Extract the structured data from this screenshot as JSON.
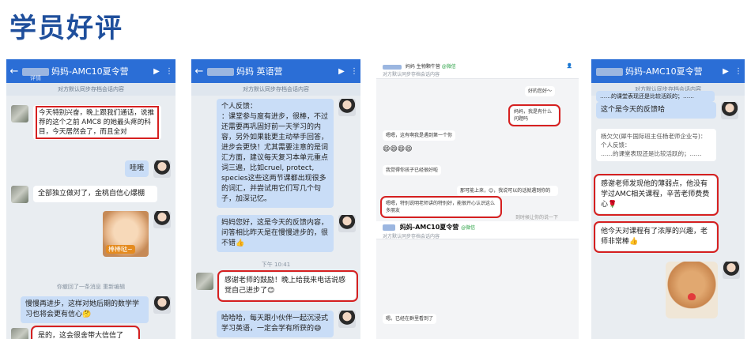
{
  "page_title": "学员好评",
  "panel1": {
    "header_title": "妈妈-AMC10夏令营",
    "header_sub": "详情",
    "notice": "对方默认同步存档会话内容",
    "msg1": "今天特别兴奋，晚上跟我们通话，说推荐的这个之前 AMC8 的她最头疼的科目，今天居然会了，而且全对",
    "msg2": "哇哦",
    "msg3": "全部独立做对了，金桃自信心爆棚",
    "sticker_text": "棒棒哒~",
    "recall": "你撤回了一条消息 重新编辑",
    "msg4": "慢慢再进步，这样对她后期的数学学习也将会更有信心🤔",
    "msg5": "是的，这会很舍带大信信了"
  },
  "panel2": {
    "header_title": "妈妈 英语营",
    "notice": "对方默认同步存档会话内容",
    "msg1": "个人反馈：\n：课堂参与度有进步，很棒，不过还需要再巩固好前一天学习的内容，另外如果能更主动举手回答，进步会更快！尤其需要注意的是词汇方面，建议每天复习本单元重点词三遍，比如cruel, protect, species这些这两节课都出现很多的词汇，并尝试用它们写几个句子，加深记忆。",
    "msg2": "妈妈您好，这是今天的反馈内容，问答相比昨天是在慢慢进步的，很不错👍",
    "time": "下午 10:41",
    "msg3": "感谢老师的鼓励！晚上给我来电话说感觉自己进步了😊",
    "msg4": "哈哈哈，每天跟小伙伴一起沉浸式学习英语，一定会学有所获的😅"
  },
  "panel3": {
    "header_title": "妈妈 生物颗牛营",
    "header_badge": "@微信",
    "header_sub": "对方默认同步存档会话内容",
    "m1": "好的您好～",
    "m2": "妈妈，我是有什么问题吗",
    "m3": "嗯嗯，这有啊我是遇到第一个你",
    "m4": "😄😄😄😄",
    "m5": "我觉得你孩子已经很好啦",
    "m6": "那可能上来，😊，我说可以的话就遇到你的",
    "m7": "嗯嗯，特别说明老师讲的特别好，能很开心认识这么多朋友",
    "m8": "到时候让你的说一下",
    "header2_title": "妈妈-AMC10夏令营",
    "header2_badge": "@微信",
    "header2_sub": "对方默认同步存档会话内容",
    "m9": "嗯。已经在群里看到了"
  },
  "panel4": {
    "header_title": "妈妈-AMC10夏令营",
    "notice": "对方默认同步存档会话内容",
    "msg0": "……的课堂表现还是比较活跃的；……",
    "msg1": "这个是今天的反馈哈",
    "quote_name": "杨欠欠(犀牛国际班主任杨老师企业号)：",
    "quote_body": "个人反馈：\n……的课堂表现还是比较活跃的；……",
    "msg2": "感谢老师发现他的薄弱点，他没有学过AMC相关课程，辛苦老师费费心🌹",
    "msg3": "他今天对课程有了浓厚的兴趣，老师非常棒👍"
  }
}
